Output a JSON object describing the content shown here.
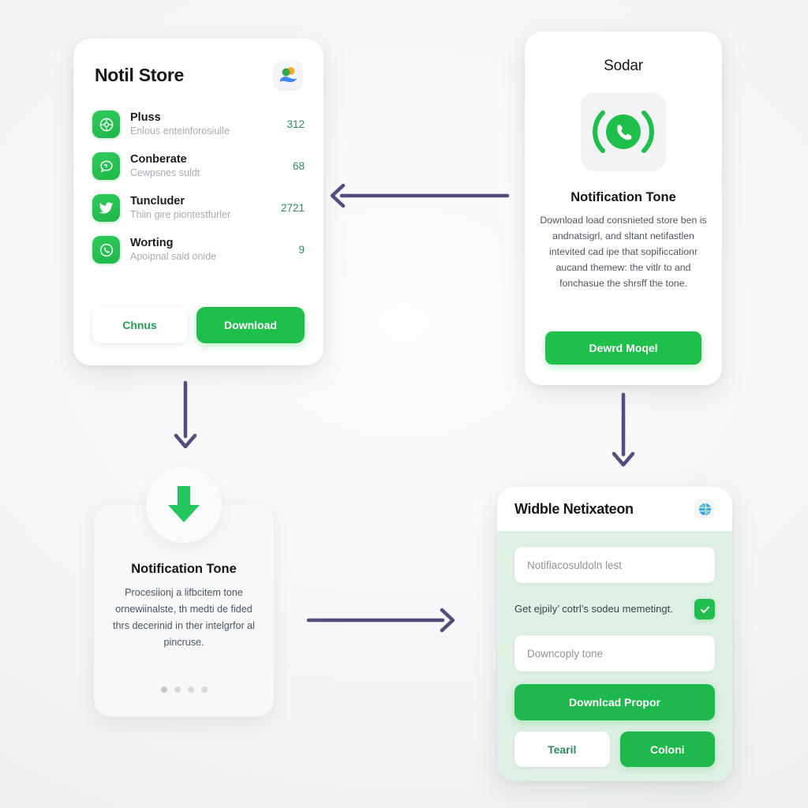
{
  "theme": {
    "accent_green": "#1fbf4c",
    "arrow_purple": "#574b7d",
    "widget_panel_green": "#dff0e4",
    "count_green": "#2f8a63",
    "background": "#f7f8f9"
  },
  "store_card": {
    "title": "Notil Store",
    "brand_icon": "google-contacts-icon",
    "apps": [
      {
        "icon": "compass-icon",
        "name": "Pluss",
        "subtitle": "Enlous enteinforosiulle",
        "count": "312"
      },
      {
        "icon": "chat-bubble-icon",
        "name": "Conberate",
        "subtitle": "Cewpsnes suldt",
        "count": "68"
      },
      {
        "icon": "twitter-bird-icon",
        "name": "Tuncluder",
        "subtitle": "Thiin gire piontestfurler",
        "count": "2721"
      },
      {
        "icon": "phone-call-icon",
        "name": "Worting",
        "subtitle": "Apoipnal said onide",
        "count": "9"
      }
    ],
    "secondary_button": "Chnus",
    "primary_button": "Download"
  },
  "tone_card": {
    "title": "Sodar",
    "hero_icon": "whatsapp-call-ringing-icon",
    "heading": "Notification Tone",
    "body": "Download load consnieted store ben is andnatsigrl, and sltant netifastlen intevited cad ipe that sopificcationr aucand themew: the vitlr to and fonchasue the shrsff the tone.",
    "button": "Dewrd Moqel"
  },
  "process_card": {
    "badge_icon": "download-arrow-icon",
    "heading": "Notification Tone",
    "body": "Procesiionj a lifbcitem tone ornewiinalste, th medti de fided thrs decerinid in ther intelgrfor al pincruse.",
    "dots": 4,
    "active_dot": 0
  },
  "widget_card": {
    "title": "Widble Netixateon",
    "head_icon": "globe-icon",
    "input_placeholder": "Notifiacosuldoln lest",
    "checkbox_label": "Get ejpily’ cotrl’s sodeu memetingt.",
    "checkbox_checked": true,
    "second_input_placeholder": "Downcoply tone",
    "primary_button": "Downlcad Propor",
    "secondary_button": "Tearil",
    "tertiary_button": "Coloni"
  },
  "arrows": [
    {
      "name": "arrow-tone-to-store",
      "direction": "left"
    },
    {
      "name": "arrow-store-to-process",
      "direction": "down"
    },
    {
      "name": "arrow-tone-to-widget",
      "direction": "down"
    },
    {
      "name": "arrow-process-to-widget",
      "direction": "right"
    }
  ]
}
